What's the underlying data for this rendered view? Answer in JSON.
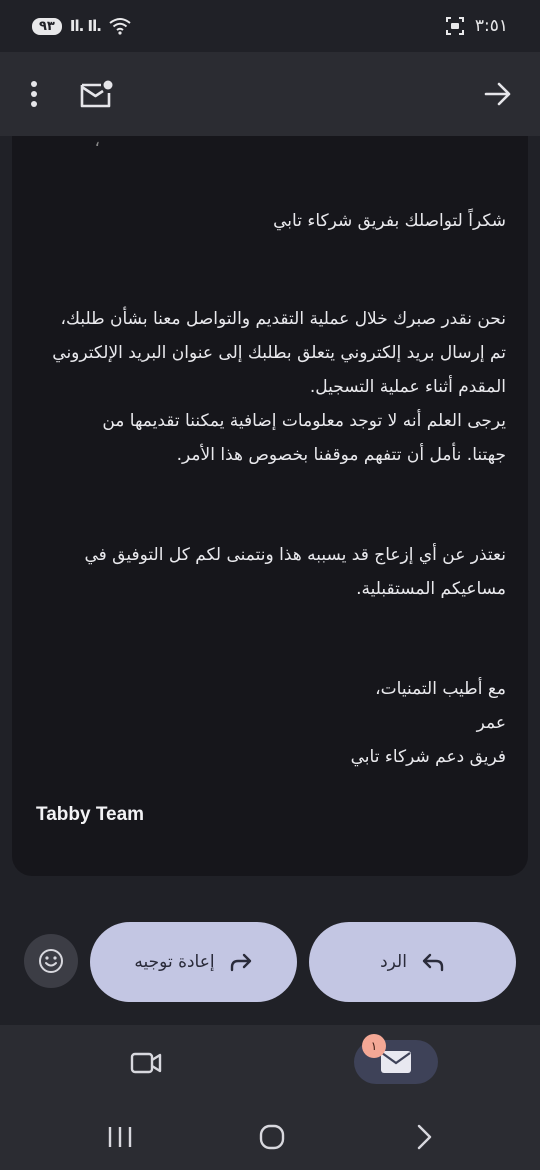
{
  "status_bar": {
    "battery": "٩٣",
    "time": "٣:٥١"
  },
  "toolbar": {
    "more_icon": "more-vert-icon",
    "mark_unread_icon": "mail-unread-icon",
    "forward_nav_icon": "arrow-right-icon"
  },
  "email": {
    "partial_line": "،",
    "greeting": "شكراً لتواصلك بفريق شركاء تابي",
    "para1": [
      "نحن نقدر صبرك خلال عملية التقديم والتواصل معنا بشأن طلبك،",
      "تم إرسال بريد إلكتروني يتعلق بطلبك إلى عنوان البريد الإلكتروني",
      "المقدم أثناء عملية التسجيل.",
      "يرجى العلم أنه لا توجد معلومات إضافية يمكننا تقديمها من",
      "جهتنا. نأمل أن تتفهم موقفنا بخصوص هذا الأمر."
    ],
    "para2": [
      "نعتذر عن أي إزعاج قد يسببه هذا ونتمنى لكم كل التوفيق في",
      "مساعيكم المستقبلية."
    ],
    "closing": [
      "مع أطيب التمنيات،",
      "عمر",
      "فريق دعم شركاء تابي"
    ],
    "signature_en": "Tabby Team"
  },
  "actions": {
    "reply_label": "الرد",
    "forward_label": "إعادة توجيه",
    "emoji_icon": "emoji-smile-icon"
  },
  "bottom_nav": {
    "mail_badge": "١"
  },
  "colors": {
    "background": "#202127",
    "card": "#16161b",
    "pill": "#c3c6e3",
    "badge": "#f4a896"
  }
}
